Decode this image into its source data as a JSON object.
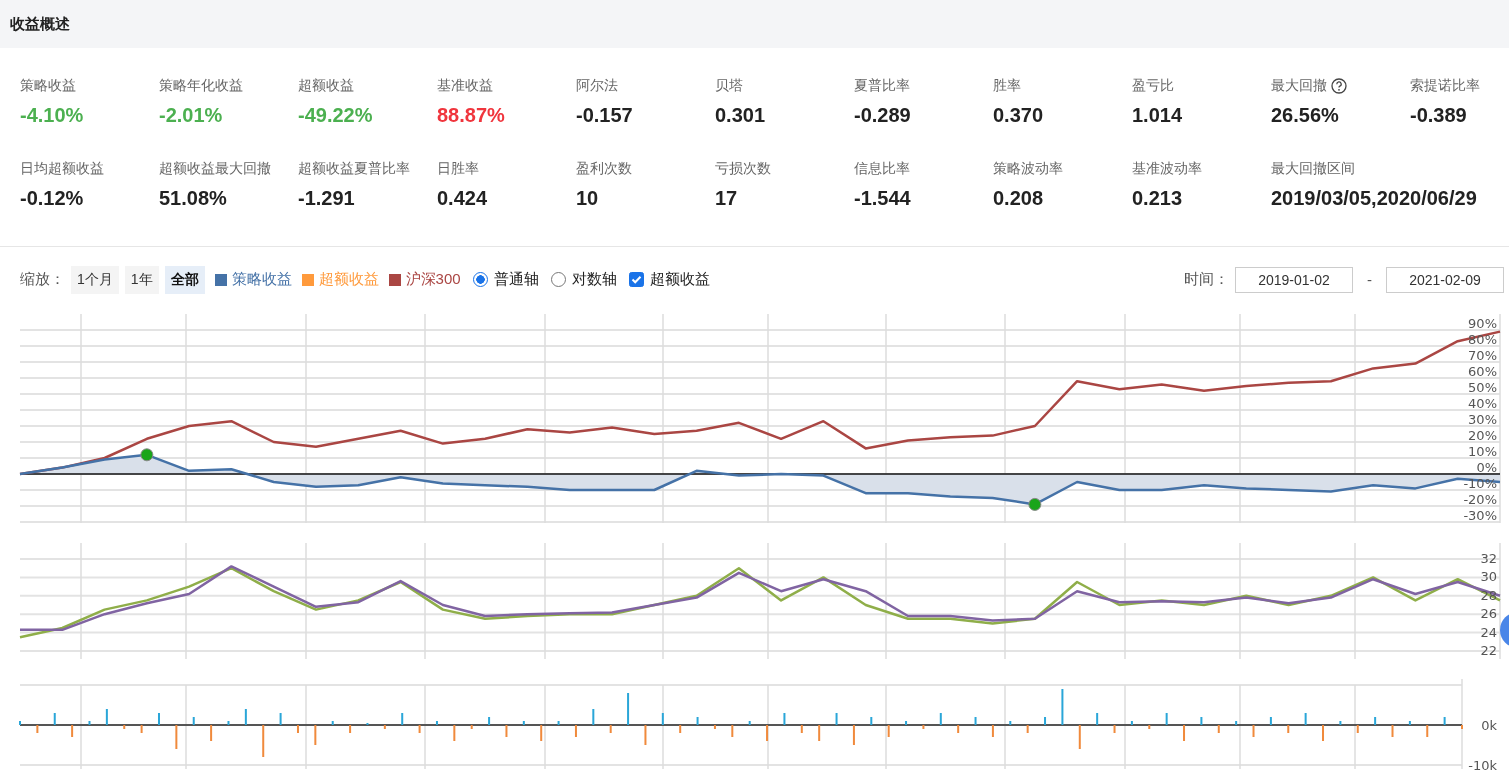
{
  "header": {
    "title": "收益概述"
  },
  "metrics": [
    {
      "label": "策略收益",
      "value": "-4.10%",
      "color": "#4cb050"
    },
    {
      "label": "策略年化收益",
      "value": "-2.01%",
      "color": "#4cb050"
    },
    {
      "label": "超额收益",
      "value": "-49.22%",
      "color": "#4cb050"
    },
    {
      "label": "基准收益",
      "value": "88.87%",
      "color": "#f0353d"
    },
    {
      "label": "阿尔法",
      "value": "-0.157"
    },
    {
      "label": "贝塔",
      "value": "0.301"
    },
    {
      "label": "夏普比率",
      "value": "-0.289"
    },
    {
      "label": "胜率",
      "value": "0.370"
    },
    {
      "label": "盈亏比",
      "value": "1.014"
    },
    {
      "label": "最大回撤",
      "value": "26.56%",
      "help": true
    },
    {
      "label": "索提诺比率",
      "value": "-0.389"
    },
    {
      "label": "日均超额收益",
      "value": "-0.12%"
    },
    {
      "label": "超额收益最大回撤",
      "value": "51.08%"
    },
    {
      "label": "超额收益夏普比率",
      "value": "-1.291"
    },
    {
      "label": "日胜率",
      "value": "0.424"
    },
    {
      "label": "盈利次数",
      "value": "10"
    },
    {
      "label": "亏损次数",
      "value": "17"
    },
    {
      "label": "信息比率",
      "value": "-1.544"
    },
    {
      "label": "策略波动率",
      "value": "0.208"
    },
    {
      "label": "基准波动率",
      "value": "0.213"
    },
    {
      "label": "最大回撤区间",
      "value": "2019/03/05,2020/06/29"
    }
  ],
  "controls": {
    "zoom_label": "缩放：",
    "zoom_buttons": [
      {
        "label": "1个月",
        "selected": false
      },
      {
        "label": "1年",
        "selected": false
      },
      {
        "label": "全部",
        "selected": true
      }
    ],
    "legend": [
      {
        "label": "策略收益",
        "color": "#4572a7"
      },
      {
        "label": "超额收益",
        "color": "#ff9a3c"
      },
      {
        "label": "沪深300",
        "color": "#aa4643"
      }
    ],
    "axis_options": [
      {
        "label": "普通轴",
        "selected": true
      },
      {
        "label": "对数轴",
        "selected": false
      }
    ],
    "excess_toggle": {
      "label": "超额收益",
      "checked": true
    },
    "time_label": "时间：",
    "start_date": "2019-01-02",
    "separator": "-",
    "end_date": "2021-02-09"
  },
  "charts": [
    {
      "chart_data": {
        "type": "line",
        "ylim": [
          -30,
          90
        ],
        "yticks": [
          {
            "value": 90,
            "label": "90%"
          },
          {
            "value": 80,
            "label": "80%"
          },
          {
            "value": 70,
            "label": "70%"
          },
          {
            "value": 60,
            "label": "60%"
          },
          {
            "value": 50,
            "label": "50%"
          },
          {
            "value": 40,
            "label": "40%"
          },
          {
            "value": 30,
            "label": "30%"
          },
          {
            "value": 20,
            "label": "20%"
          },
          {
            "value": 10,
            "label": "10%"
          },
          {
            "value": 0,
            "label": "0%"
          },
          {
            "value": -10,
            "label": "-10%"
          },
          {
            "value": -20,
            "label": "-20%"
          },
          {
            "value": -30,
            "label": "-30%"
          }
        ],
        "series": [
          {
            "color": "#aa4643",
            "values": [
              0,
              4,
              10,
              22,
              30,
              33,
              20,
              17,
              22,
              27,
              19,
              22,
              28,
              26,
              29,
              25,
              27,
              32,
              22,
              33,
              16,
              21,
              23,
              24,
              30,
              58,
              53,
              56,
              52,
              55,
              57,
              58,
              66,
              69,
              83,
              89
            ]
          },
          {
            "color": "#4572a7",
            "values": [
              0,
              4,
              9,
              12,
              2,
              3,
              -5,
              -8,
              -7,
              -2,
              -6,
              -7,
              -8,
              -10,
              -10,
              -10,
              2,
              -1,
              0,
              -1,
              -12,
              -12,
              -14,
              -15,
              -19,
              -5,
              -10,
              -10,
              -7,
              -9,
              -10,
              -11,
              -7,
              -9,
              -3,
              -5
            ]
          }
        ],
        "grid": true
      }
    },
    {
      "chart_data": {
        "type": "line",
        "ylim": [
          22,
          32
        ],
        "yticks": [
          32,
          30,
          28,
          26,
          24,
          22
        ],
        "grid": true,
        "series": [
          {
            "color": "#8fae49",
            "values": [
              23.5,
              24.5,
              26.5,
              27.5,
              29,
              31,
              28.5,
              26.5,
              27.5,
              29.5,
              26.5,
              25.5,
              25.8,
              26,
              26,
              27,
              28,
              31,
              27.5,
              30,
              27,
              25.5,
              25.5,
              25,
              25.5,
              29.5,
              27,
              27.5,
              27,
              28,
              27,
              28,
              30,
              27.5,
              29.8,
              27.5
            ]
          },
          {
            "color": "#8064a2",
            "values": [
              24.3,
              24.3,
              26,
              27.2,
              28.2,
              31.2,
              29,
              26.8,
              27.3,
              29.6,
              27,
              25.8,
              26,
              26.1,
              26.2,
              27,
              27.8,
              30.5,
              28.5,
              29.8,
              28.5,
              25.8,
              25.8,
              25.3,
              25.5,
              28.5,
              27.3,
              27.4,
              27.3,
              27.8,
              27.2,
              27.8,
              29.8,
              28.2,
              29.5,
              28
            ]
          }
        ]
      }
    },
    {
      "chart_data": {
        "type": "bar",
        "ylim": [
          -10,
          10
        ],
        "yticks": [
          {
            "value": 0,
            "label": "0k"
          },
          {
            "value": -10,
            "label": "-10k"
          }
        ],
        "grid": true,
        "values": [
          1,
          -2,
          3,
          -3,
          1,
          4,
          -1,
          -2,
          3,
          -6,
          2,
          -4,
          1,
          4,
          -8,
          3,
          -2,
          -5,
          1,
          -2,
          0.5,
          -1,
          3,
          -2,
          1,
          -4,
          -1,
          2,
          -3,
          1,
          -4,
          1,
          -3,
          4,
          -2,
          8,
          -5,
          3,
          -2,
          2,
          -1,
          -3,
          1,
          -4,
          3,
          -2,
          -4,
          3,
          -5,
          2,
          -3,
          1,
          -1,
          3,
          -2,
          2,
          -3,
          1,
          -2,
          2,
          9,
          -6,
          3,
          -2,
          1,
          -1,
          3,
          -4,
          2,
          -2,
          1,
          -3,
          2,
          -2,
          3,
          -4,
          1,
          -2,
          2,
          -3,
          1,
          -3,
          2,
          -1
        ]
      }
    }
  ],
  "floating_button": true
}
